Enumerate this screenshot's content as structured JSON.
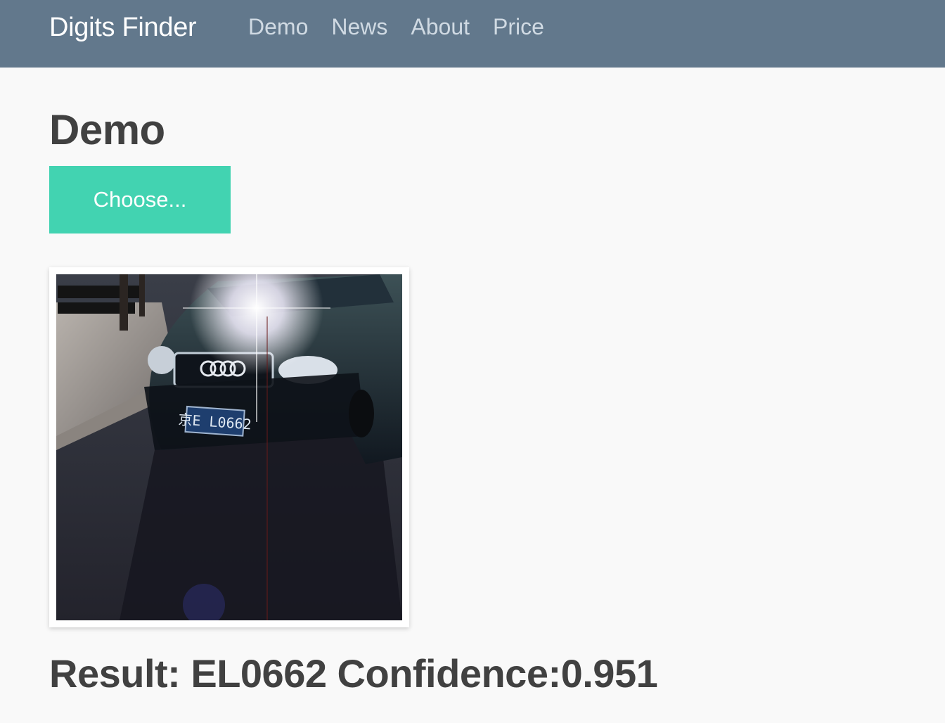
{
  "navbar": {
    "brand": "Digits Finder",
    "links": [
      "Demo",
      "News",
      "About",
      "Price"
    ],
    "background": "#62788c"
  },
  "main": {
    "title": "Demo",
    "choose_button": "Choose...",
    "accent": "#42d3b1",
    "photo": {
      "plate_text": "京E L0662"
    },
    "result_text": "Result: EL0662 Confidence:0.951"
  }
}
